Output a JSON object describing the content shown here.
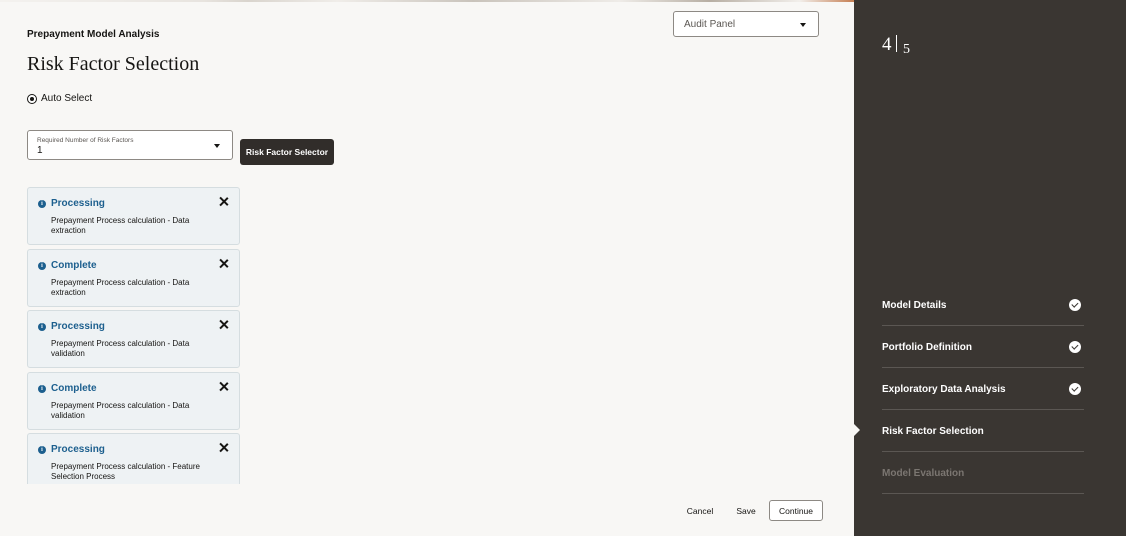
{
  "header": {
    "subtitle": "Prepayment Model Analysis",
    "title": "Risk Factor Selection",
    "audit_panel_label": "Audit Panel"
  },
  "radio": {
    "label": "Auto Select",
    "selected": true
  },
  "risk_factors": {
    "field_label": "Required Number of Risk Factors",
    "value": "1",
    "button_label": "Risk Factor Selector"
  },
  "messages": [
    {
      "title": "Processing",
      "detail": "Prepayment Process calculation - Data extraction"
    },
    {
      "title": "Complete",
      "detail": "Prepayment Process calculation - Data extraction"
    },
    {
      "title": "Processing",
      "detail": "Prepayment Process calculation - Data validation"
    },
    {
      "title": "Complete",
      "detail": "Prepayment Process calculation - Data validation"
    },
    {
      "title": "Processing",
      "detail": "Prepayment Process calculation - Feature Selection Process"
    }
  ],
  "footer": {
    "cancel_label": "Cancel",
    "save_label": "Save",
    "continue_label": "Continue"
  },
  "sidebar": {
    "current_step": "4",
    "total_steps": "5",
    "steps": [
      {
        "label": "Model Details",
        "state": "complete"
      },
      {
        "label": "Portfolio Definition",
        "state": "complete"
      },
      {
        "label": "Exploratory Data Analysis",
        "state": "complete"
      },
      {
        "label": "Risk Factor Selection",
        "state": "active"
      },
      {
        "label": "Model Evaluation",
        "state": "disabled"
      }
    ]
  },
  "colors": {
    "sidebar_bg": "#3a3632",
    "accent_blue": "#1c5f8e",
    "primary_button": "#312d2a",
    "page_bg": "#f8f7f5"
  }
}
